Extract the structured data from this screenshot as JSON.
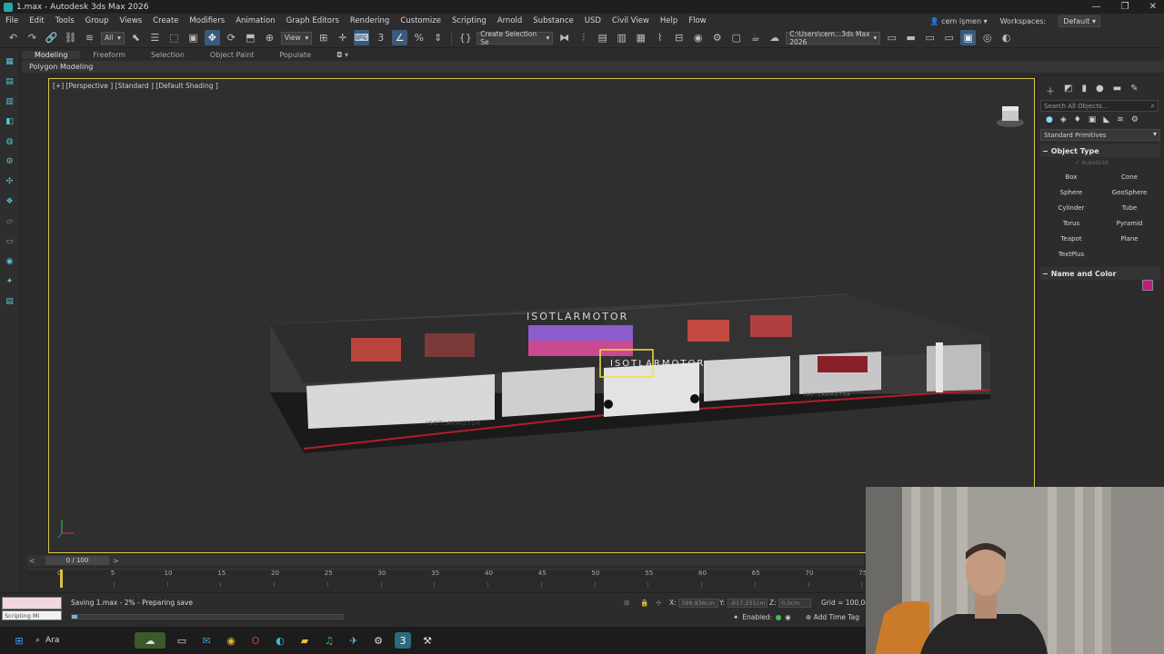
{
  "window": {
    "title": "1.max - Autodesk 3ds Max 2026",
    "controls": [
      "—",
      "❐",
      "✕"
    ]
  },
  "menu": {
    "items": [
      "File",
      "Edit",
      "Tools",
      "Group",
      "Views",
      "Create",
      "Modifiers",
      "Animation",
      "Graph Editors",
      "Rendering",
      "Customize",
      "Scripting",
      "Arnold",
      "Substance",
      "USD",
      "Civil View",
      "Help",
      "Flow"
    ],
    "user": "cem işmen",
    "workspaces_label": "Workspaces:",
    "workspace_value": "Default"
  },
  "toolbar": {
    "filter_value": "All",
    "view_value": "View",
    "selection_set_placeholder": "Create Selection Se",
    "project_path": "C:\\Users\\cem...3ds Max 2026"
  },
  "ribbon": {
    "tabs": [
      "Modeling",
      "Freeform",
      "Selection",
      "Object Paint",
      "Populate"
    ],
    "sub_label": "Polygon Modeling"
  },
  "viewport": {
    "label": "[+] [Perspective ] [Standard ] [Default Shading ]",
    "brand_text": "ISOTLARMOTOR",
    "colors": {
      "frame": "#d7c64c",
      "background": "#2f2f2f",
      "selection": "#f2e33c"
    }
  },
  "command_panel": {
    "search_placeholder": "Search All Objects...",
    "category": "Standard Primitives",
    "object_type_label": "Object Type",
    "autogrid_label": "AutoGrid",
    "objects": [
      "Box",
      "Cone",
      "Sphere",
      "GeoSphere",
      "Cylinder",
      "Tube",
      "Torus",
      "Pyramid",
      "Teapot",
      "Plane",
      "TextPlus"
    ],
    "name_color_label": "Name and Color",
    "object_color": "#c01a7a"
  },
  "timeline": {
    "current": "0 / 100",
    "ticks": [
      "0",
      "5",
      "10",
      "15",
      "20",
      "25",
      "30",
      "35",
      "40",
      "45",
      "50",
      "55",
      "60",
      "65",
      "70",
      "75"
    ]
  },
  "status": {
    "script_label": "Scripting Mi",
    "saving_text": "Saving 1.max - 2% - Preparing save",
    "progress_percent": 2,
    "x_label": "X:",
    "x_value": "399,936cm",
    "y_label": "Y:",
    "y_value": "-817,251cm",
    "z_label": "Z:",
    "z_value": "0,0cm",
    "grid_text": "Grid = 100,0cm",
    "enabled_label": "Enabled:",
    "add_time_tag": "Add Time Tag"
  },
  "taskbar": {
    "search_label": "Ara"
  }
}
